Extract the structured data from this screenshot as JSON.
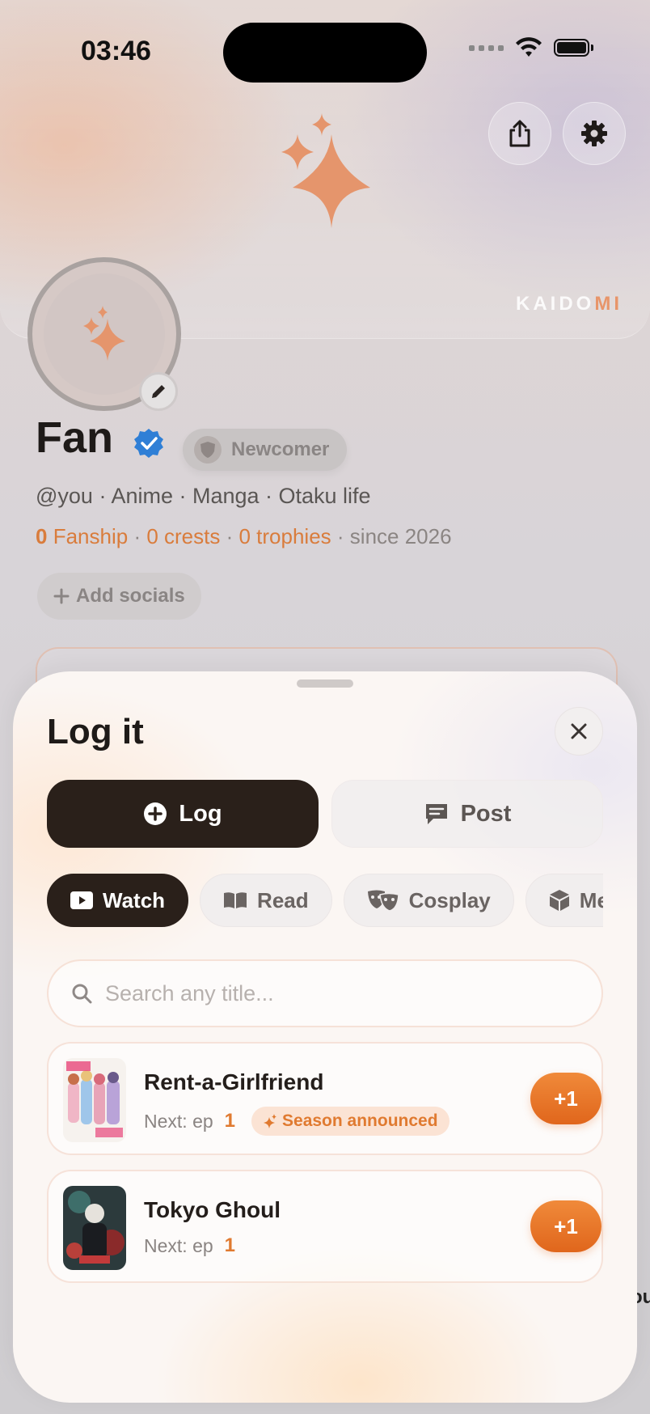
{
  "status": {
    "time": "03:46"
  },
  "brand": {
    "prefix": "KAIDO",
    "suffix": "MI"
  },
  "profile": {
    "name": "Fan",
    "badge": "Newcomer",
    "bio": "@you · Anime · Manga · Otaku life",
    "stats": {
      "fanship_count": "0",
      "fanship_label": "Fanship",
      "crests": "0 crests",
      "trophies": "0 trophies",
      "since": "since 2026"
    },
    "add_socials": "Add socials"
  },
  "sheet": {
    "title": "Log it",
    "modes": {
      "log": "Log",
      "post": "Post"
    },
    "categories": [
      "Watch",
      "Read",
      "Cosplay",
      "Merch"
    ],
    "search_placeholder": "Search any title...",
    "items": [
      {
        "title": "Rent-a-Girlfriend",
        "next_label": "Next: ep",
        "episode": "1",
        "tag": "Season announced",
        "action": "+1"
      },
      {
        "title": "Tokyo Ghoul",
        "next_label": "Next: ep",
        "episode": "1",
        "action": "+1"
      }
    ]
  },
  "edge_text": "ou",
  "colors": {
    "accent": "#e07a30",
    "dark": "#2a201a",
    "verified": "#2f7fd6"
  }
}
